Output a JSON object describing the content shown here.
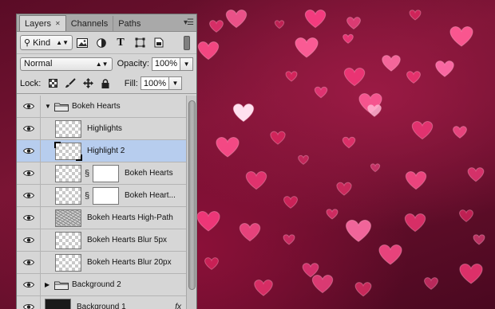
{
  "tabs": [
    {
      "label": "Layers",
      "active": true
    },
    {
      "label": "Channels",
      "active": false
    },
    {
      "label": "Paths",
      "active": false
    }
  ],
  "filter": {
    "kind_label": "Kind",
    "icons": [
      "pixel-filter-icon",
      "adjustment-filter-icon",
      "type-filter-icon",
      "shape-filter-icon",
      "smart-object-filter-icon"
    ]
  },
  "blend": {
    "mode": "Normal",
    "opacity_label": "Opacity:",
    "opacity_value": "100%"
  },
  "lock": {
    "label": "Lock:",
    "fill_label": "Fill:",
    "fill_value": "100%"
  },
  "layers": [
    {
      "name": "Bokeh Hearts",
      "type": "group",
      "expanded": true,
      "indent": 0
    },
    {
      "name": "Highlights",
      "type": "layer",
      "thumb": "transparent",
      "indent": 1
    },
    {
      "name": "Highlight 2",
      "type": "layer",
      "thumb": "bracket",
      "indent": 1,
      "selected": true
    },
    {
      "name": "Bokeh Hearts",
      "type": "masked",
      "thumb": "transparent",
      "indent": 1
    },
    {
      "name": "Bokeh Heart...",
      "type": "masked",
      "thumb": "transparent",
      "indent": 1
    },
    {
      "name": "Bokeh Hearts High-Path",
      "type": "layer",
      "thumb": "noise",
      "indent": 1
    },
    {
      "name": "Bokeh Hearts Blur 5px",
      "type": "layer",
      "thumb": "transparent",
      "indent": 1
    },
    {
      "name": "Bokeh Hearts Blur 20px",
      "type": "layer",
      "thumb": "transparent",
      "indent": 1
    },
    {
      "name": "Background 2",
      "type": "group",
      "expanded": false,
      "indent": 0
    },
    {
      "name": "Background 1",
      "type": "layer",
      "thumb": "dark",
      "indent": 0,
      "fx": "fx"
    }
  ],
  "colors": {
    "selection": "#b7cdee",
    "panel": "#d6d6d6",
    "canvas": "#6a0f2e"
  }
}
